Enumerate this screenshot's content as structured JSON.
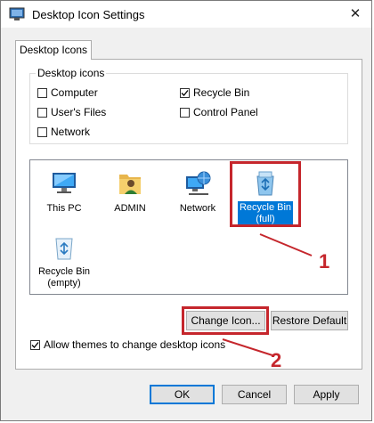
{
  "window": {
    "title": "Desktop Icon Settings",
    "close_glyph": "✕"
  },
  "tabs": [
    {
      "label": "Desktop Icons",
      "active": true
    }
  ],
  "desktop_icons_group": {
    "legend": "Desktop icons",
    "checkboxes": [
      {
        "label": "Computer",
        "checked": false
      },
      {
        "label": "Recycle Bin",
        "checked": true
      },
      {
        "label": "User's Files",
        "checked": false
      },
      {
        "label": "Control Panel",
        "checked": false
      },
      {
        "label": "Network",
        "checked": false
      }
    ]
  },
  "icon_list": [
    {
      "label": "This PC",
      "icon": "this-pc-icon"
    },
    {
      "label": "ADMIN",
      "icon": "user-folder-icon"
    },
    {
      "label": "Network",
      "icon": "network-icon"
    },
    {
      "label": "Recycle Bin\n(full)",
      "line1": "Recycle Bin",
      "line2": "(full)",
      "icon": "recycle-bin-full-icon",
      "selected": true
    },
    {
      "label": "Recycle Bin\n(empty)",
      "line1": "Recycle Bin",
      "line2": "(empty)",
      "icon": "recycle-bin-empty-icon"
    }
  ],
  "buttons": {
    "change_icon": "Change Icon...",
    "restore_default": "Restore Default",
    "ok": "OK",
    "cancel": "Cancel",
    "apply": "Apply"
  },
  "allow_themes": {
    "label": "Allow themes to change desktop icons",
    "checked": true
  },
  "annotations": [
    {
      "number": "1"
    },
    {
      "number": "2"
    }
  ],
  "colors": {
    "annotation": "#c5262c",
    "selection": "#0078d7"
  }
}
